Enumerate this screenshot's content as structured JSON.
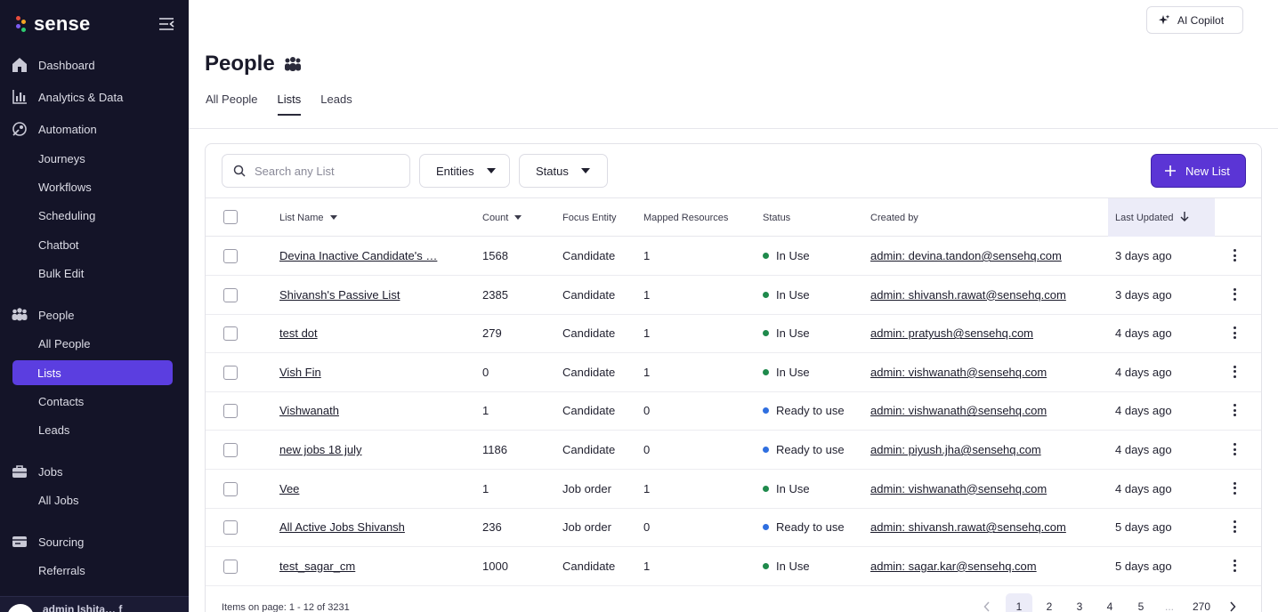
{
  "brand": {
    "name": "sense",
    "dot_colors": [
      "#e84d3d",
      "#f5a623",
      "#7b5cf0",
      "#2ecc71"
    ]
  },
  "sidebar": {
    "sections": [
      {
        "label": "Dashboard",
        "icon": "home-icon"
      },
      {
        "label": "Analytics & Data",
        "icon": "bar-chart-icon"
      },
      {
        "label": "Automation",
        "icon": "rocket-icon",
        "items": [
          "Journeys",
          "Workflows",
          "Scheduling",
          "Chatbot",
          "Bulk Edit"
        ]
      },
      {
        "label": "People",
        "icon": "people-icon",
        "items": [
          "All People",
          "Lists",
          "Contacts",
          "Leads"
        ]
      },
      {
        "label": "Jobs",
        "icon": "briefcase-icon",
        "items": [
          "All Jobs"
        ]
      },
      {
        "label": "Sourcing",
        "icon": "sourcing-icon",
        "items": [
          "Referrals"
        ]
      }
    ],
    "active_item": "Lists",
    "footer_text": "admin Ishita…  f"
  },
  "header": {
    "copilot_label": "AI Copilot",
    "title": "People"
  },
  "tabs": [
    {
      "label": "All People",
      "active": false
    },
    {
      "label": "Lists",
      "active": true
    },
    {
      "label": "Leads",
      "active": false
    }
  ],
  "toolbar": {
    "search_placeholder": "Search any List",
    "entities_label": "Entities",
    "status_label": "Status",
    "new_list_label": "New List"
  },
  "table": {
    "columns": [
      "List Name",
      "Count",
      "Focus Entity",
      "Mapped Resources",
      "Status",
      "Created by",
      "Last Updated"
    ],
    "sorted_column": "Last Updated",
    "rows": [
      {
        "name": "Devina Inactive Candidate's …",
        "count": "1568",
        "entity": "Candidate",
        "mapped": "1",
        "status": "In Use",
        "created_by": "admin: devina.tandon@sensehq.com",
        "updated": "3 days ago"
      },
      {
        "name": "Shivansh's Passive List",
        "count": "2385",
        "entity": "Candidate",
        "mapped": "1",
        "status": "In Use",
        "created_by": "admin: shivansh.rawat@sensehq.com",
        "updated": "3 days ago"
      },
      {
        "name": "test dot",
        "count": "279",
        "entity": "Candidate",
        "mapped": "1",
        "status": "In Use",
        "created_by": "admin: pratyush@sensehq.com",
        "updated": "4 days ago"
      },
      {
        "name": "Vish Fin",
        "count": "0",
        "entity": "Candidate",
        "mapped": "1",
        "status": "In Use",
        "created_by": "admin: vishwanath@sensehq.com",
        "updated": "4 days ago"
      },
      {
        "name": "Vishwanath",
        "count": "1",
        "entity": "Candidate",
        "mapped": "0",
        "status": "Ready to use",
        "created_by": "admin: vishwanath@sensehq.com",
        "updated": "4 days ago"
      },
      {
        "name": "new jobs 18 july",
        "count": "1186",
        "entity": "Candidate",
        "mapped": "0",
        "status": "Ready to use",
        "created_by": "admin: piyush.jha@sensehq.com",
        "updated": "4 days ago"
      },
      {
        "name": "Vee",
        "count": "1",
        "entity": "Job order",
        "mapped": "1",
        "status": "In Use",
        "created_by": "admin: vishwanath@sensehq.com",
        "updated": "4 days ago"
      },
      {
        "name": "All Active Jobs Shivansh",
        "count": "236",
        "entity": "Job order",
        "mapped": "0",
        "status": "Ready to use",
        "created_by": "admin: shivansh.rawat@sensehq.com",
        "updated": "5 days ago"
      },
      {
        "name": "test_sagar_cm",
        "count": "1000",
        "entity": "Candidate",
        "mapped": "1",
        "status": "In Use",
        "created_by": "admin: sagar.kar@sensehq.com",
        "updated": "5 days ago"
      }
    ]
  },
  "status_colors": {
    "In Use": "#1f8a4c",
    "Ready to use": "#2f6fe0"
  },
  "pagination": {
    "info": "Items on page: 1 - 12 of 3231",
    "pages": [
      "1",
      "2",
      "3",
      "4",
      "5",
      "...",
      "270"
    ],
    "current": "1"
  }
}
